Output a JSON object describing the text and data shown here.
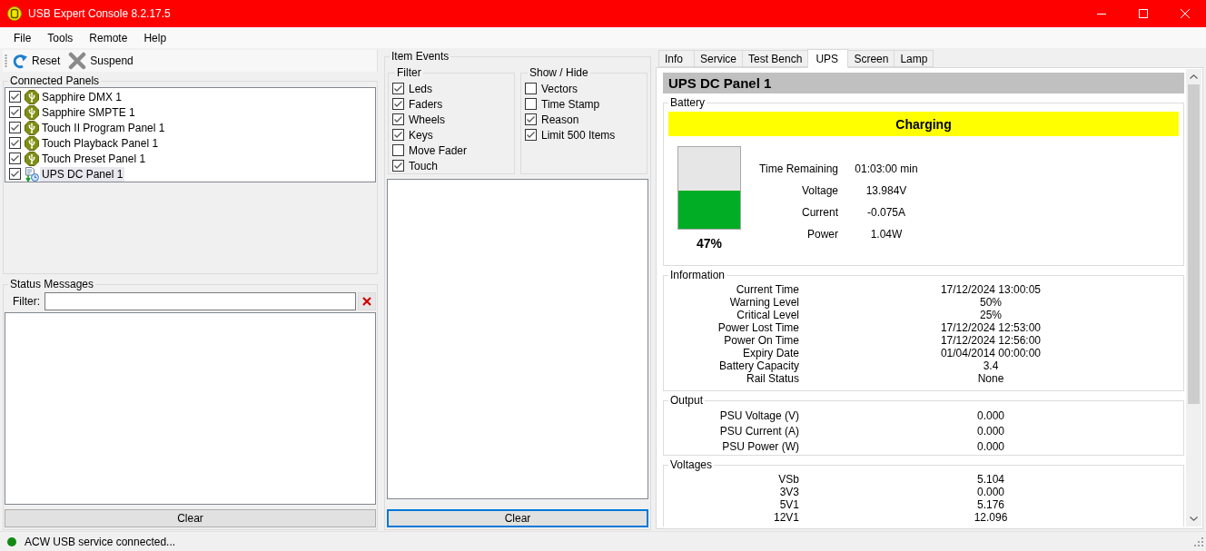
{
  "window": {
    "title": "USB Expert Console 8.2.17.5"
  },
  "menu": [
    {
      "label": "File"
    },
    {
      "label": "Tools"
    },
    {
      "label": "Remote"
    },
    {
      "label": "Help"
    }
  ],
  "toolbar": [
    {
      "kind": "reset",
      "label": "Reset"
    },
    {
      "kind": "suspend",
      "label": "Suspend"
    }
  ],
  "connected_panels": {
    "title": "Connected Panels",
    "items": [
      {
        "kind": "usb",
        "name": "Sapphire DMX 1",
        "checked": true,
        "selected": false
      },
      {
        "kind": "usb",
        "name": "Sapphire SMPTE 1",
        "checked": true,
        "selected": false
      },
      {
        "kind": "usb",
        "name": "Touch II Program Panel 1",
        "checked": true,
        "selected": false
      },
      {
        "kind": "usb",
        "name": "Touch Playback Panel 1",
        "checked": true,
        "selected": false
      },
      {
        "kind": "usb",
        "name": "Touch Preset Panel 1",
        "checked": true,
        "selected": false
      },
      {
        "kind": "ups",
        "name": "UPS DC Panel 1",
        "checked": true,
        "selected": true
      }
    ]
  },
  "status_messages": {
    "title": "Status Messages",
    "filter_label": "Filter:",
    "clear_button": {
      "label": "Clear",
      "focused": false
    }
  },
  "item_events": {
    "title": "Item Events",
    "filter": {
      "title": "Filter",
      "options": [
        {
          "label": "Leds",
          "checked": true
        },
        {
          "label": "Faders",
          "checked": true
        },
        {
          "label": "Wheels",
          "checked": true
        },
        {
          "label": "Keys",
          "checked": true
        },
        {
          "label": "Move Fader",
          "checked": false
        },
        {
          "label": "Touch",
          "checked": true
        }
      ]
    },
    "show_hide": {
      "title": "Show / Hide",
      "options": [
        {
          "label": "Vectors",
          "checked": false
        },
        {
          "label": "Time Stamp",
          "checked": false
        },
        {
          "label": "Reason",
          "checked": true
        },
        {
          "label": "Limit 500 Items",
          "checked": true
        }
      ]
    },
    "clear_button": {
      "label": "Clear",
      "focused": true
    }
  },
  "tabs": [
    {
      "label": "Info",
      "selected": false
    },
    {
      "label": "Service",
      "selected": false
    },
    {
      "label": "Test Bench",
      "selected": false
    },
    {
      "label": "UPS",
      "selected": true
    },
    {
      "label": "Screen",
      "selected": false
    },
    {
      "label": "Lamp",
      "selected": false
    }
  ],
  "ups": {
    "header": "UPS DC Panel 1",
    "battery": {
      "title": "Battery",
      "status": "Charging",
      "level": 0.47,
      "percent": "47%",
      "stats": [
        {
          "label": "Time Remaining",
          "value": "01:03:00 min"
        },
        {
          "label": "Voltage",
          "value": "13.984V"
        },
        {
          "label": "Current",
          "value": "-0.075A"
        },
        {
          "label": "Power",
          "value": "1.04W"
        }
      ]
    },
    "information": {
      "title": "Information",
      "rows": [
        {
          "label": "Current Time",
          "value": "17/12/2024 13:00:05"
        },
        {
          "label": "Warning Level",
          "value": "50%"
        },
        {
          "label": "Critical Level",
          "value": "25%"
        },
        {
          "label": "Power Lost Time",
          "value": "17/12/2024 12:53:00"
        },
        {
          "label": "Power On Time",
          "value": "17/12/2024 12:56:00"
        },
        {
          "label": "Expiry Date",
          "value": "01/04/2014 00:00:00"
        },
        {
          "label": "Battery Capacity",
          "value": "3.4"
        },
        {
          "label": "Rail Status",
          "value": "None"
        }
      ]
    },
    "output": {
      "title": "Output",
      "rows": [
        {
          "label": "PSU Voltage (V)",
          "value": "0.000"
        },
        {
          "label": "PSU Current (A)",
          "value": "0.000"
        },
        {
          "label": "PSU Power (W)",
          "value": "0.000"
        }
      ]
    },
    "voltages": {
      "title": "Voltages",
      "rows": [
        {
          "label": "VSb",
          "value": "5.104"
        },
        {
          "label": "3V3",
          "value": "0.000"
        },
        {
          "label": "5V1",
          "value": "5.176"
        },
        {
          "label": "12V1",
          "value": "12.096"
        }
      ]
    }
  },
  "status_bar": {
    "connected": true,
    "text": "ACW USB service connected..."
  }
}
